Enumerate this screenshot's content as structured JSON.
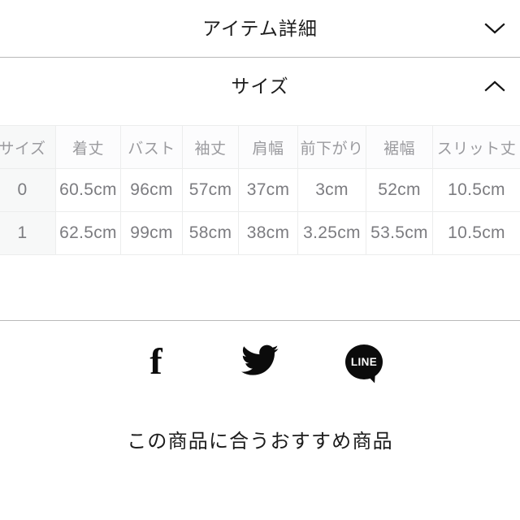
{
  "sections": [
    {
      "title": "アイテム詳細",
      "expanded": false,
      "toggle_icon": "chevron-down-icon"
    },
    {
      "title": "サイズ",
      "expanded": true,
      "toggle_icon": "chevron-up-icon"
    }
  ],
  "size_table": {
    "headers": [
      "サイズ",
      "着丈",
      "バスト",
      "袖丈",
      "肩幅",
      "前下がり",
      "裾幅",
      "スリット丈"
    ],
    "rows": [
      [
        "0",
        "60.5cm",
        "96cm",
        "57cm",
        "37cm",
        "3cm",
        "52cm",
        "10.5cm"
      ],
      [
        "1",
        "62.5cm",
        "99cm",
        "58cm",
        "38cm",
        "3.25cm",
        "53.5cm",
        "10.5cm"
      ]
    ]
  },
  "share": {
    "items": [
      {
        "name": "facebook-share-button",
        "icon": "facebook-icon",
        "glyph": "f"
      },
      {
        "name": "twitter-share-button",
        "icon": "twitter-icon",
        "glyph": ""
      },
      {
        "name": "line-share-button",
        "icon": "line-icon",
        "glyph": "LINE"
      }
    ]
  },
  "recommend": {
    "heading": "この商品に合うおすすめ商品"
  },
  "colors": {
    "text_dark": "#1c1c1c",
    "text_muted": "#7c7c80",
    "header_muted": "#9a9a9e",
    "divider": "#b9b9b9",
    "cell_border": "#eceded",
    "sticky_col_bg": "#f7f8f8",
    "icon_black": "#0b0b0b"
  }
}
